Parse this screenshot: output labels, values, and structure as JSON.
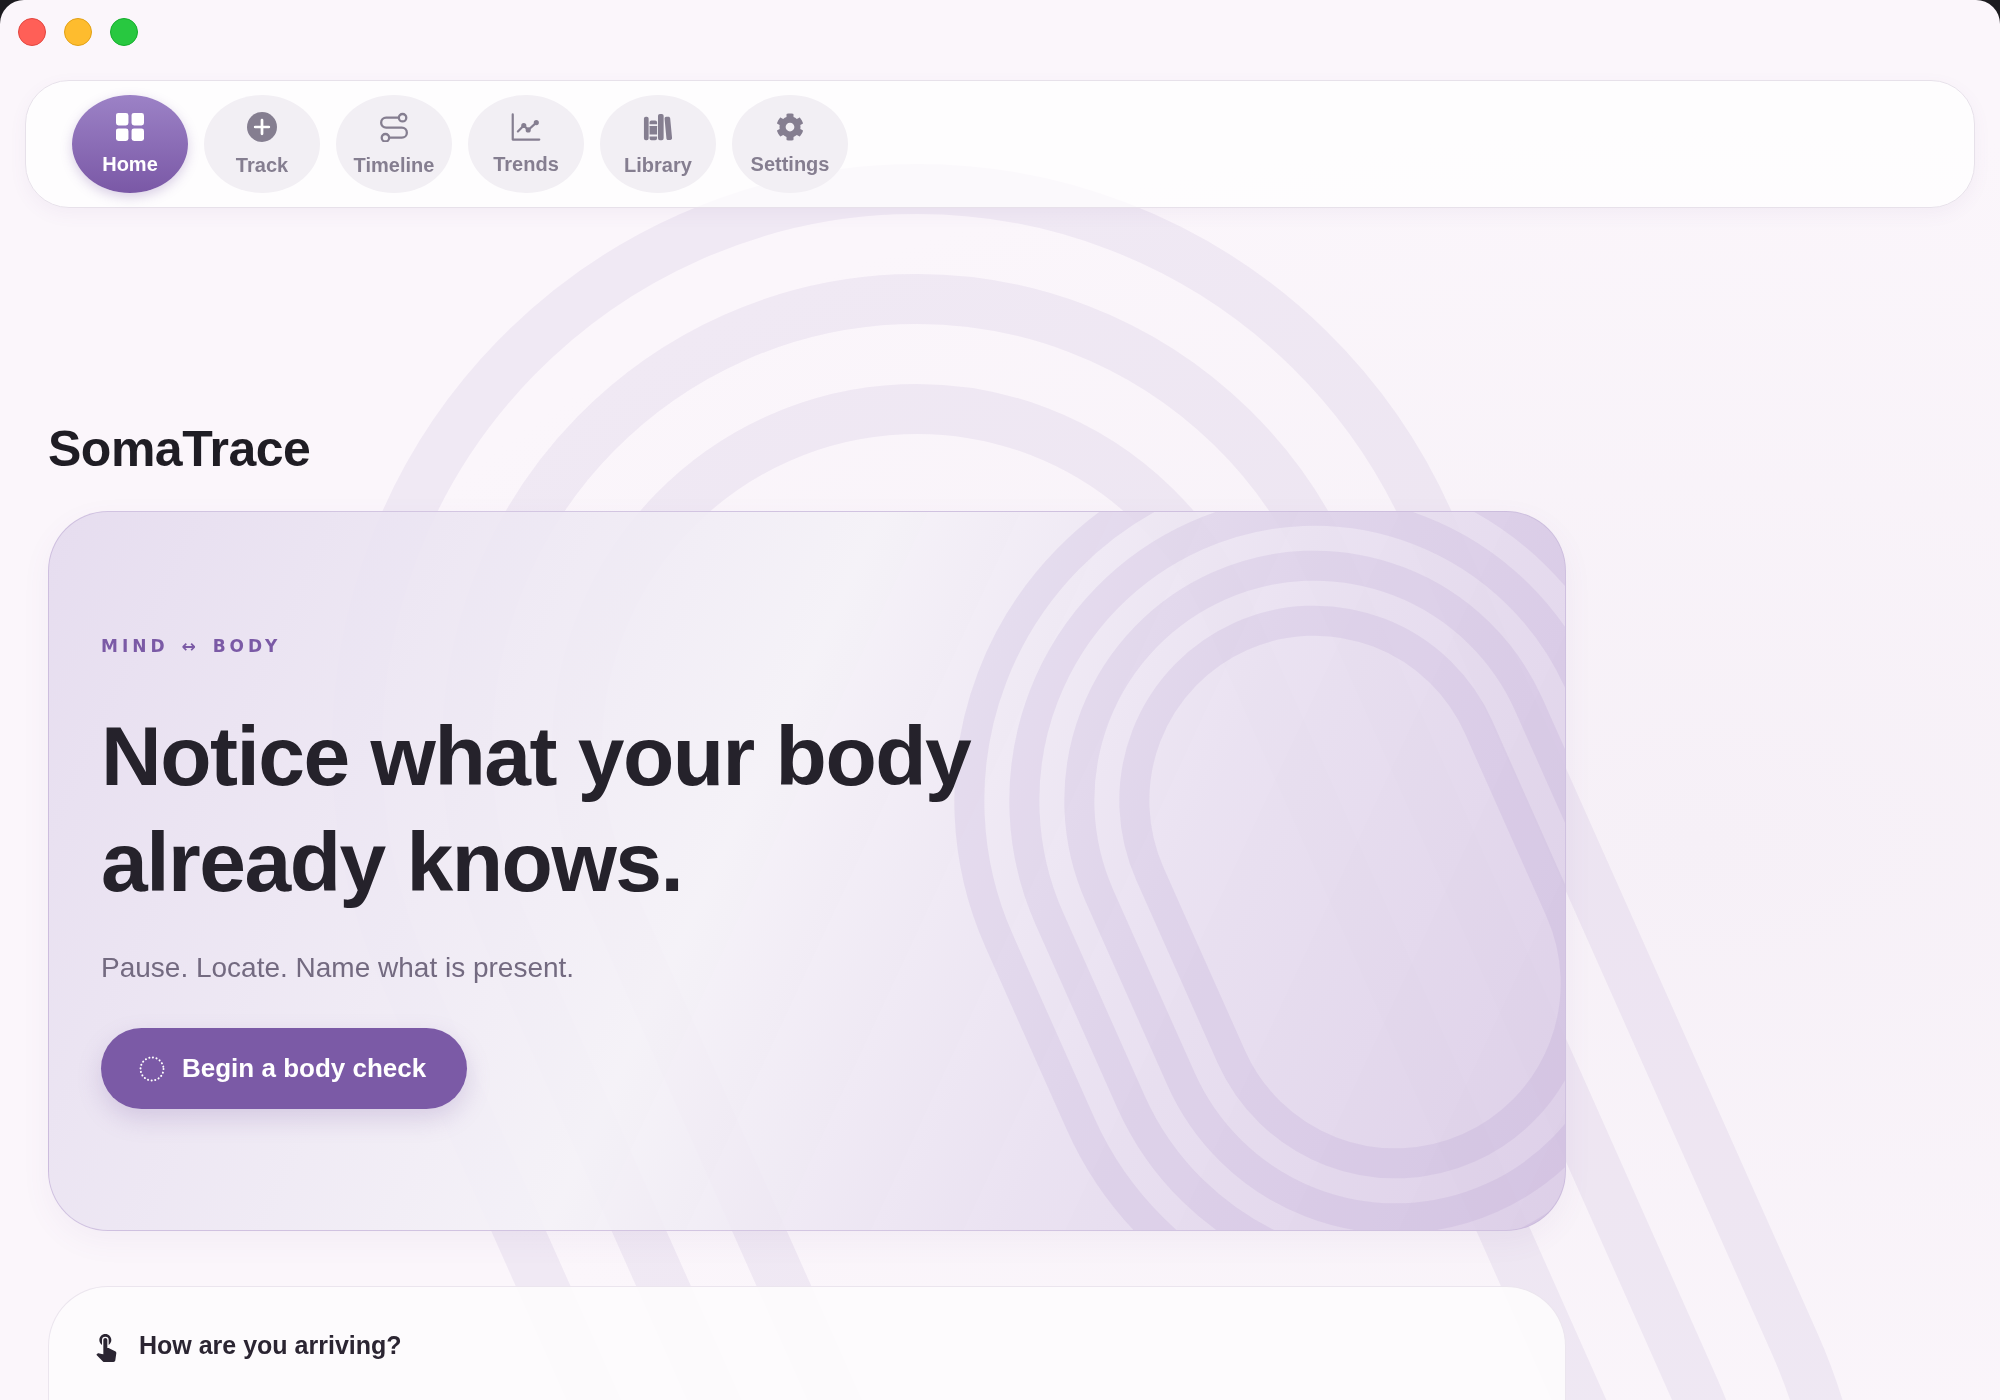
{
  "nav": {
    "items": [
      {
        "label": "Home",
        "selected": true
      },
      {
        "label": "Track",
        "selected": false
      },
      {
        "label": "Timeline",
        "selected": false
      },
      {
        "label": "Trends",
        "selected": false
      },
      {
        "label": "Library",
        "selected": false
      },
      {
        "label": "Settings",
        "selected": false
      }
    ]
  },
  "app_title": "SomaTrace",
  "hero": {
    "eyebrow": "MIND ↔ BODY",
    "headline": "Notice what your body already knows.",
    "subtitle": "Pause. Locate. Name what is present.",
    "button": "Begin a body check"
  },
  "checkin_card": {
    "title": "How are you arriving?"
  }
}
